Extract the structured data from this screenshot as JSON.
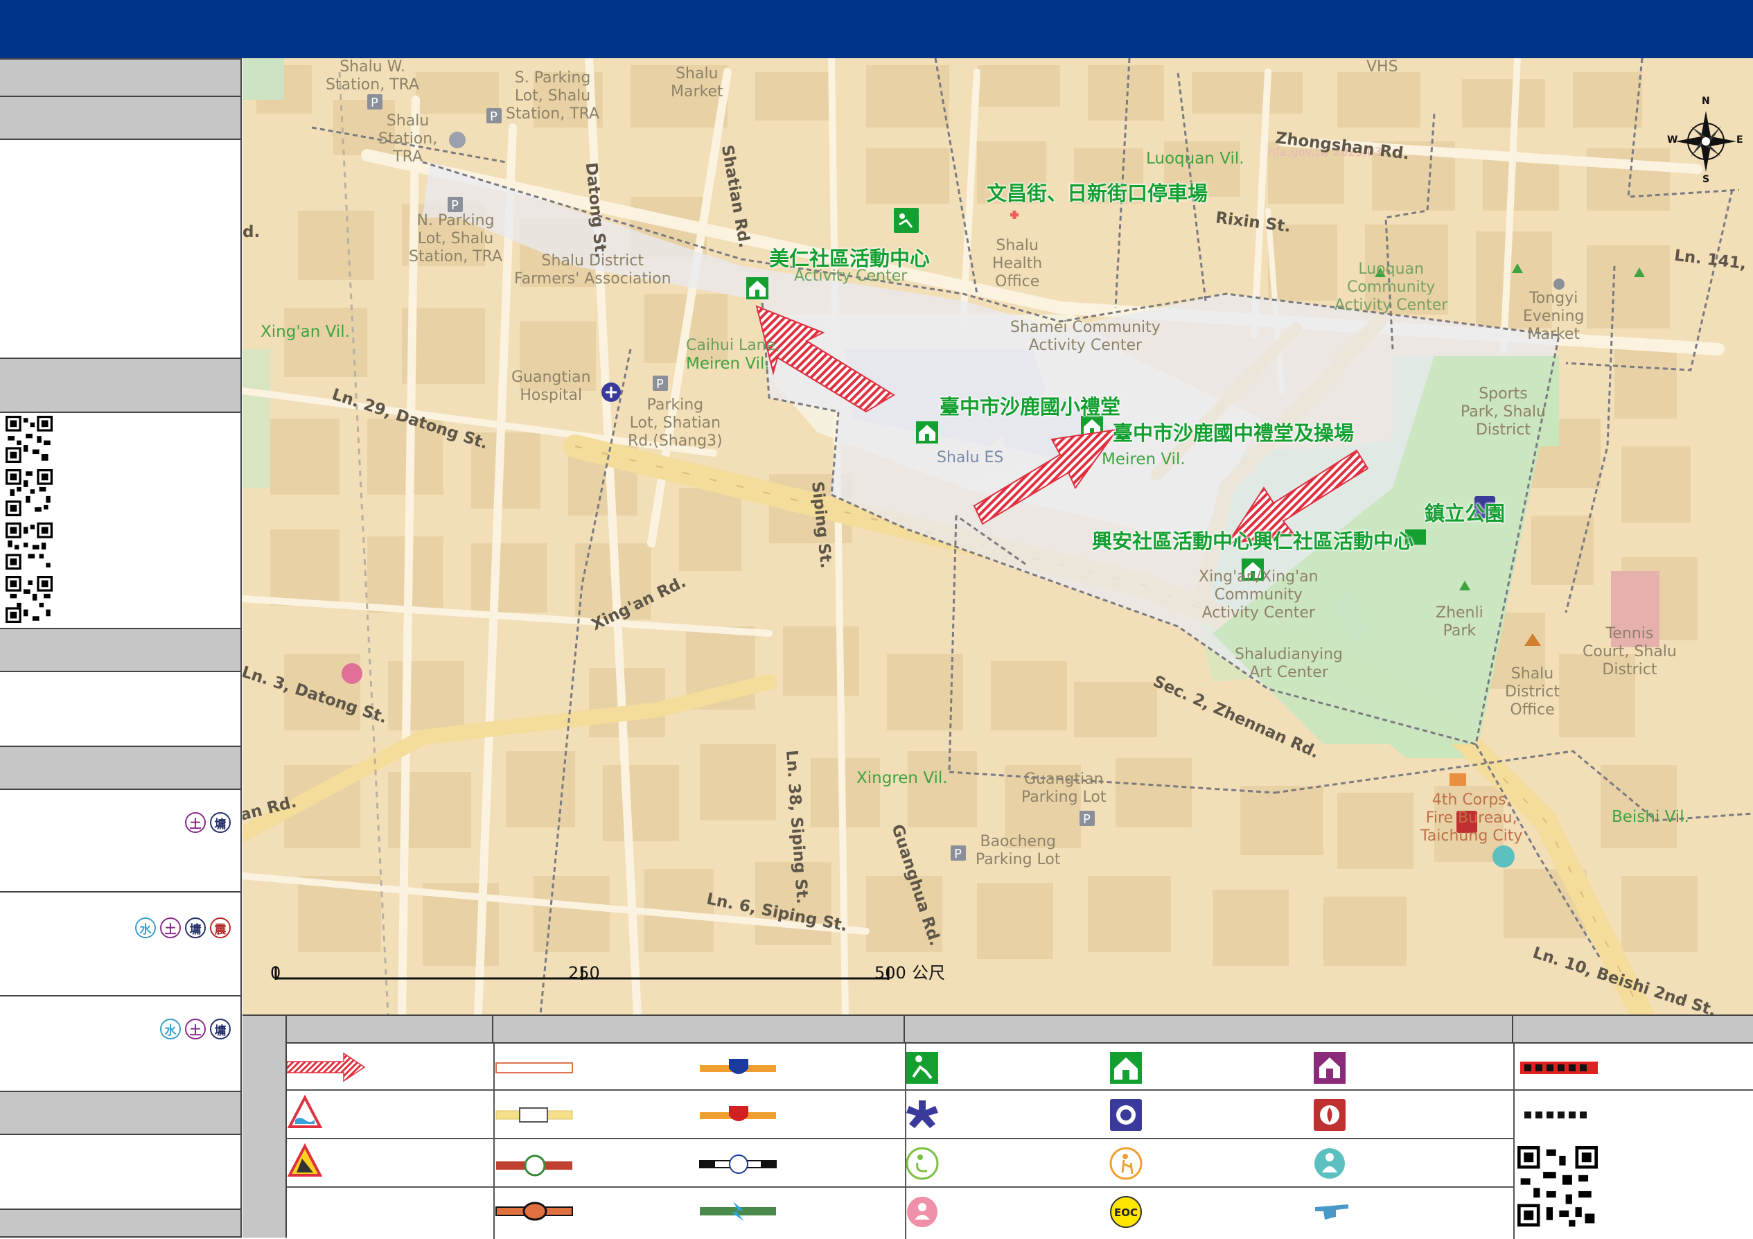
{
  "map": {
    "shelters": [
      {
        "id": "meiren",
        "label": "美仁社區活動中心"
      },
      {
        "id": "wenchang",
        "label": "文昌街、日新街口停車場"
      },
      {
        "id": "es",
        "label": "臺中市沙鹿國小禮堂"
      },
      {
        "id": "jhs",
        "label": "臺中市沙鹿國中禮堂及操場"
      },
      {
        "id": "park",
        "label": "鎮立公園"
      },
      {
        "id": "xingan",
        "label": "興安社區活動中心興仁社區活動中心"
      }
    ],
    "places": [
      {
        "id": "shalu-w-station",
        "label": "Shalu W.\nStation, TRA"
      },
      {
        "id": "s-parking",
        "label": "S. Parking\nLot, Shalu\nStation, TRA"
      },
      {
        "id": "shalu-market",
        "label": "Shalu\nMarket"
      },
      {
        "id": "shalu-station",
        "label": "Shalu\nStation,\nTRA"
      },
      {
        "id": "n-parking",
        "label": "N. Parking\nLot, Shalu\nStation, TRA"
      },
      {
        "id": "farmers",
        "label": "Shalu District\nFarmers' Association"
      },
      {
        "id": "meiren-activity",
        "label": "Activity Center"
      },
      {
        "id": "health",
        "label": "Shalu\nHealth\nOffice"
      },
      {
        "id": "luoquan-center",
        "label": "Luoquan\nCommunity\nActivity Center"
      },
      {
        "id": "tongyi",
        "label": "Tongyi\nEvening\nMarket"
      },
      {
        "id": "shamei",
        "label": "Shamei Community\nActivity Center"
      },
      {
        "id": "caihui",
        "label": "Caihui Lane,"
      },
      {
        "id": "guangtian",
        "label": "Guangtian\nHospital"
      },
      {
        "id": "parking-shang3",
        "label": "Parking\nLot, Shatian\nRd.(Shang3)"
      },
      {
        "id": "shalu-es",
        "label": "Shalu ES"
      },
      {
        "id": "sports-park",
        "label": "Sports\nPark, Shalu\nDistrict"
      },
      {
        "id": "xingan-center",
        "label": "Xing'an/Xing'an\nCommunity\nActivity Center"
      },
      {
        "id": "zhenli",
        "label": "Zhenli\nPark"
      },
      {
        "id": "art-center",
        "label": "Shaludianying\nArt Center"
      },
      {
        "id": "tennis",
        "label": "Tennis\nCourt, Shalu\nDistrict"
      },
      {
        "id": "district-office",
        "label": "Shalu\nDistrict\nOffice"
      },
      {
        "id": "fire",
        "label": "4th Corps,\nFire Bureau,\nTaichung City"
      },
      {
        "id": "guangtian-parking",
        "label": "Guangtian\nParking Lot"
      },
      {
        "id": "baocheng",
        "label": "Baocheng\nParking Lot"
      },
      {
        "id": "vhs",
        "label": "VHS"
      },
      {
        "id": "watermark",
        "label": "nfa.gov.tw 2023/03"
      }
    ],
    "villages": [
      {
        "id": "luoquan",
        "label": "Luoquan Vil."
      },
      {
        "id": "xingan-vil",
        "label": "Xing'an Vil."
      },
      {
        "id": "meiren-vil-1",
        "label": "Meiren Vil."
      },
      {
        "id": "meiren-vil-2",
        "label": "Meiren Vil."
      },
      {
        "id": "xingren",
        "label": "Xingren Vil."
      },
      {
        "id": "beishi",
        "label": "Beishi Vil."
      }
    ],
    "roads": [
      {
        "id": "zhongshan",
        "label": "Zhongshan Rd."
      },
      {
        "id": "rixin",
        "label": "Rixin St."
      },
      {
        "id": "ln141",
        "label": "Ln. 141,"
      },
      {
        "id": "datong",
        "label": "Datong St."
      },
      {
        "id": "shatian",
        "label": "Shatian Rd."
      },
      {
        "id": "ln29",
        "label": "Ln. 29, Datong St."
      },
      {
        "id": "siping",
        "label": "Siping St."
      },
      {
        "id": "xingan-rd",
        "label": "Xing'an Rd."
      },
      {
        "id": "zhennan",
        "label": "Sec. 2, Zhennan Rd."
      },
      {
        "id": "ln3",
        "label": "Ln. 3, Datong St."
      },
      {
        "id": "ln38",
        "label": "Ln. 38, Siping St."
      },
      {
        "id": "guanghua",
        "label": "Guanghua Rd."
      },
      {
        "id": "ln6",
        "label": "Ln. 6, Siping St."
      },
      {
        "id": "ln10",
        "label": "Ln. 10, Beishi 2nd St."
      },
      {
        "id": "an-rd",
        "label": "an Rd."
      },
      {
        "id": "rd-d",
        "label": "d."
      }
    ],
    "scale": {
      "ticks": [
        "0",
        "250",
        "500"
      ],
      "unit": "公尺"
    },
    "compass": {
      "n": "N",
      "s": "S",
      "e": "E",
      "w": "W"
    }
  },
  "sidebar": {
    "hazards": [
      {
        "badges": [
          {
            "char": "土",
            "kind": "soil"
          },
          {
            "char": "墉",
            "kind": "land"
          }
        ]
      },
      {
        "badges": [
          {
            "char": "水",
            "kind": "water"
          },
          {
            "char": "土",
            "kind": "soil"
          },
          {
            "char": "墉",
            "kind": "land"
          },
          {
            "char": "震",
            "kind": "quake"
          }
        ]
      },
      {
        "badges": [
          {
            "char": "水",
            "kind": "water"
          },
          {
            "char": "土",
            "kind": "soil"
          },
          {
            "char": "墉",
            "kind": "land"
          }
        ]
      }
    ]
  },
  "legend": {
    "eoc_label": "EOC"
  },
  "colors": {
    "title_bar": "#00338a",
    "shelter_green": "#14a030",
    "evac_arrow": "#e03040",
    "map_background": "#f2dfb8"
  }
}
